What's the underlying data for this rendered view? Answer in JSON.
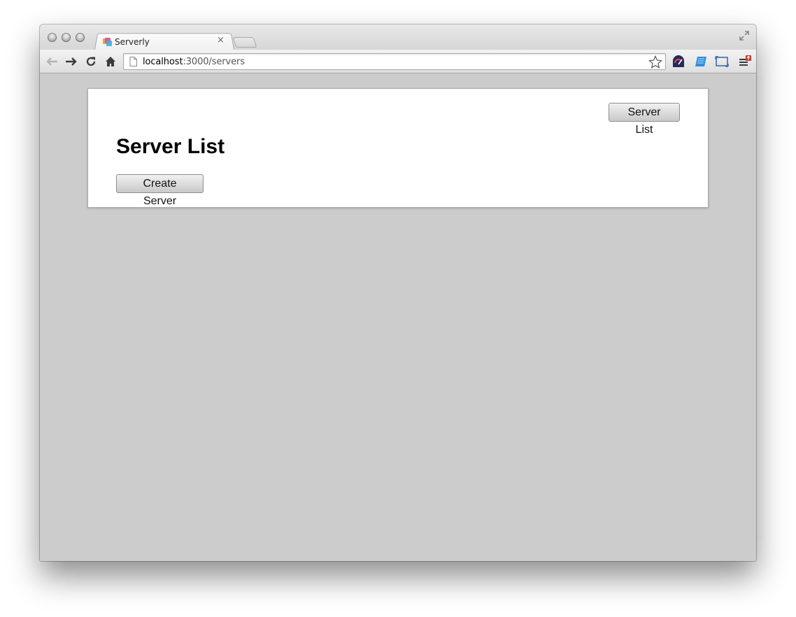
{
  "browser": {
    "tab": {
      "title": "Serverly"
    },
    "address_bar": {
      "host": "localhost",
      "rest": ":3000/servers"
    }
  },
  "page": {
    "nav_button_label": "Server List",
    "heading": "Server List",
    "create_button_label": "Create Server"
  }
}
